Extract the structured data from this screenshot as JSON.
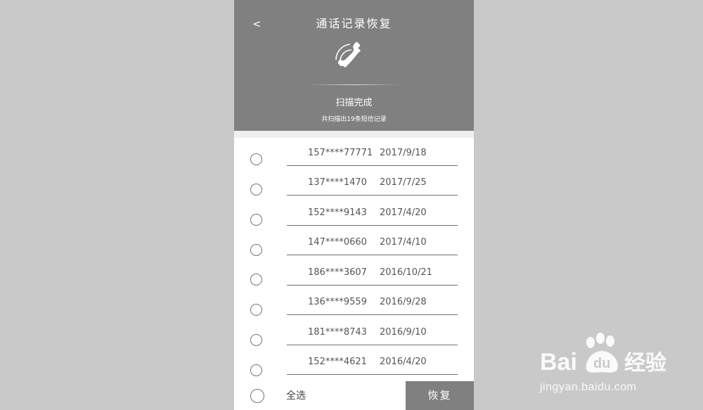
{
  "header": {
    "back_label": "<",
    "title": "通话记录恢复",
    "icon": "phone-call-icon",
    "scan_status": "扫描完成",
    "scan_count": "共扫描出19条短信记录"
  },
  "records": [
    {
      "number": "157****77771",
      "date": "2017/9/18"
    },
    {
      "number": "137****1470",
      "date": "2017/7/25"
    },
    {
      "number": "152****9143",
      "date": "2017/4/20"
    },
    {
      "number": "147****0660",
      "date": "2017/4/10"
    },
    {
      "number": "186****3607",
      "date": "2016/10/21"
    },
    {
      "number": "136****9559",
      "date": "2016/9/28"
    },
    {
      "number": "181****8743",
      "date": "2016/9/10"
    },
    {
      "number": "152****4621",
      "date": "2016/4/20"
    }
  ],
  "footer": {
    "select_all_label": "全选",
    "restore_label": "恢复"
  },
  "watermark": {
    "brand_en": "Bai",
    "brand_du": "du",
    "brand_cn": "经验",
    "url": "jingyan.baidu.com"
  },
  "colors": {
    "header_bg": "#808080",
    "page_bg": "#c9c9c9",
    "text": "#555555"
  }
}
